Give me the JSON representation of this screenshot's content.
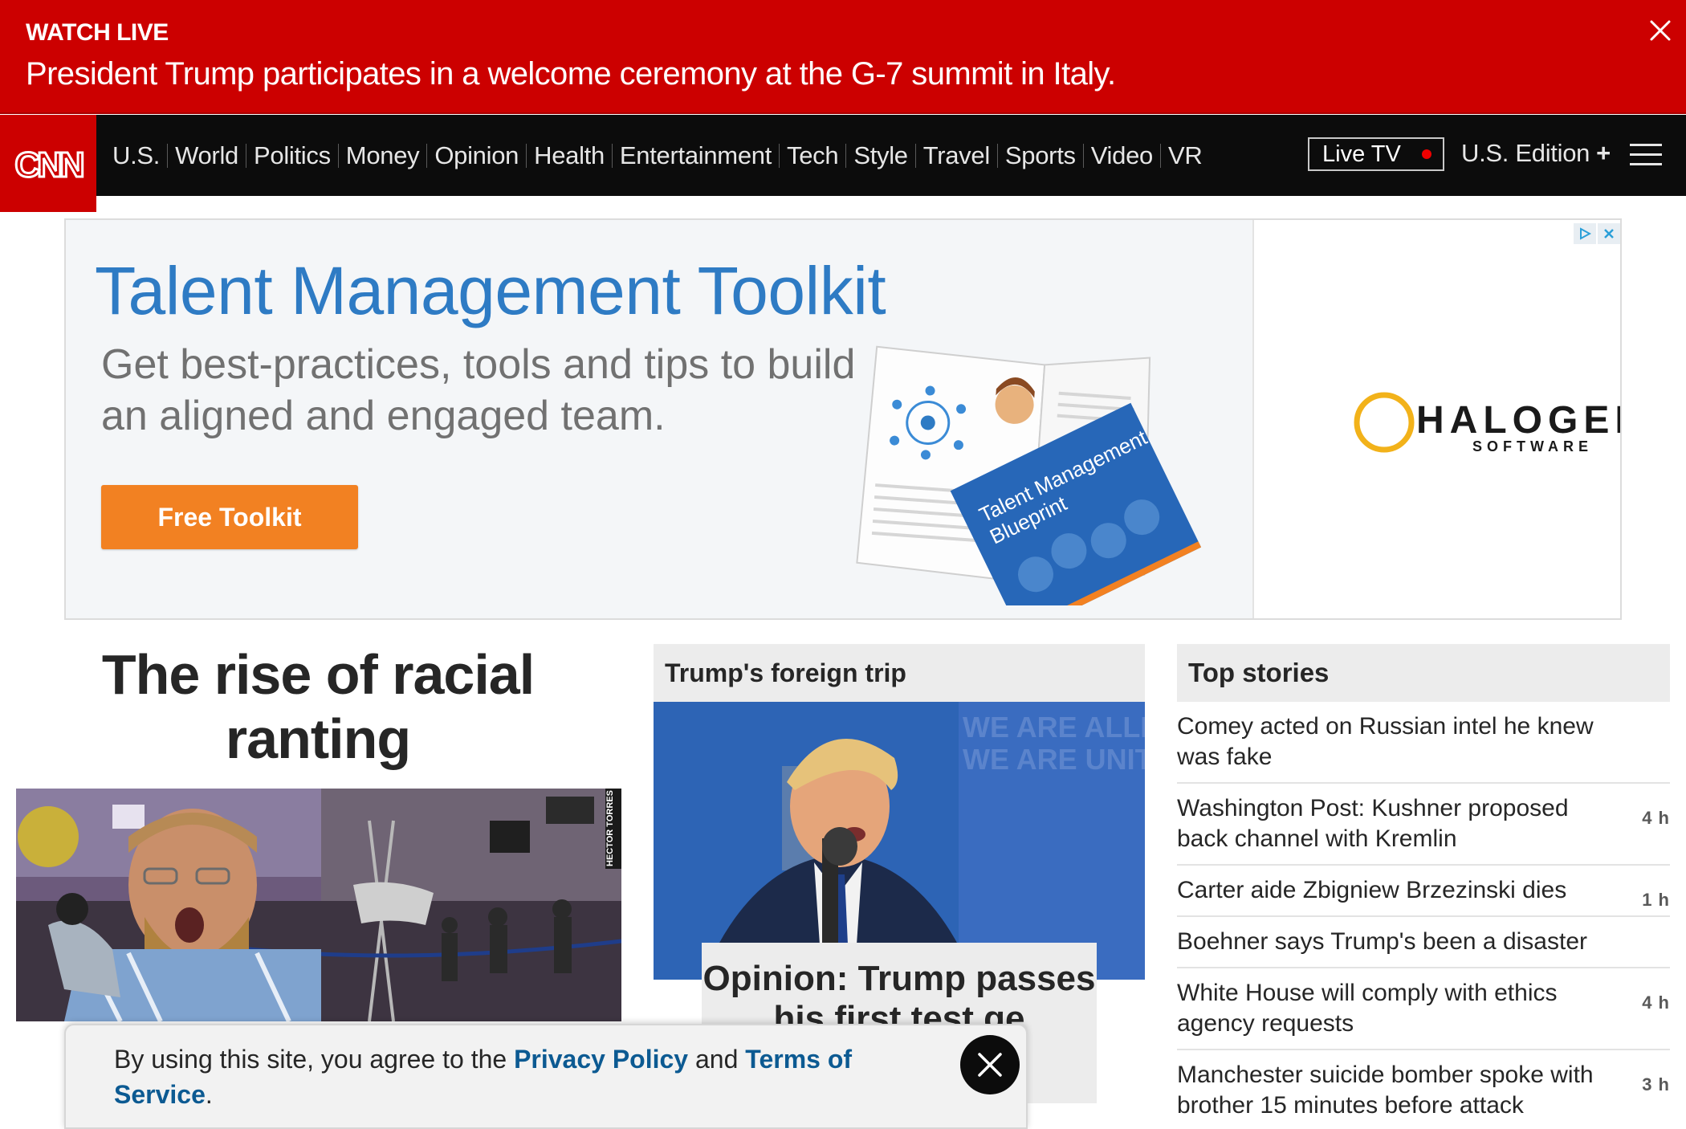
{
  "banner": {
    "kicker": "WATCH LIVE",
    "headline": "President Trump participates in a welcome ceremony at the G-7 summit in Italy.",
    "color": "#cc0000"
  },
  "nav": {
    "logo_text": "CNN",
    "links": [
      "U.S.",
      "World",
      "Politics",
      "Money",
      "Opinion",
      "Health",
      "Entertainment",
      "Tech",
      "Style",
      "Travel",
      "Sports",
      "Video",
      "VR"
    ],
    "live_tv": "Live TV",
    "edition": "U.S. Edition",
    "edition_plus": "+"
  },
  "ad": {
    "title": "Talent Management Toolkit",
    "subtitle": "Get best-practices, tools and tips to build an aligned and engaged team.",
    "button": "Free Toolkit",
    "booklet_title_1": "Talent Management",
    "booklet_title_2": "Blueprint",
    "brand": "HALOGEN",
    "brand_sub": "SOFTWARE",
    "brand_color": "#f2b21a",
    "title_color": "#2e7bc4",
    "button_color": "#f28122"
  },
  "lead": {
    "headline": "The rise of racial ranting",
    "credit": "HECTOR TORRES"
  },
  "middle": {
    "section": "Trump's foreign trip",
    "backdrop_text_1": "WE ARE ALLIES",
    "backdrop_text_2": "WE ARE UNITED",
    "caption": "Opinion: Trump passes his first test ge"
  },
  "top_stories": {
    "header": "Top stories",
    "items": [
      {
        "title": "Comey acted on Russian intel he knew was fake",
        "time": ""
      },
      {
        "title": "Washington Post: Kushner proposed back channel with Kremlin",
        "time": "4 h"
      },
      {
        "title": "Carter aide Zbigniew Brzezinski dies",
        "time": "1 h"
      },
      {
        "title": "Boehner says Trump's been a disaster",
        "time": ""
      },
      {
        "title": "White House will comply with ethics agency requests",
        "time": "4 h"
      },
      {
        "title": "Manchester suicide bomber spoke with brother 15 minutes before attack",
        "time": "3 h"
      }
    ]
  },
  "cookie": {
    "prefix": "By using this site, you agree to the ",
    "privacy": "Privacy Policy",
    "and": " and ",
    "terms": "Terms of Service",
    "suffix": "."
  }
}
